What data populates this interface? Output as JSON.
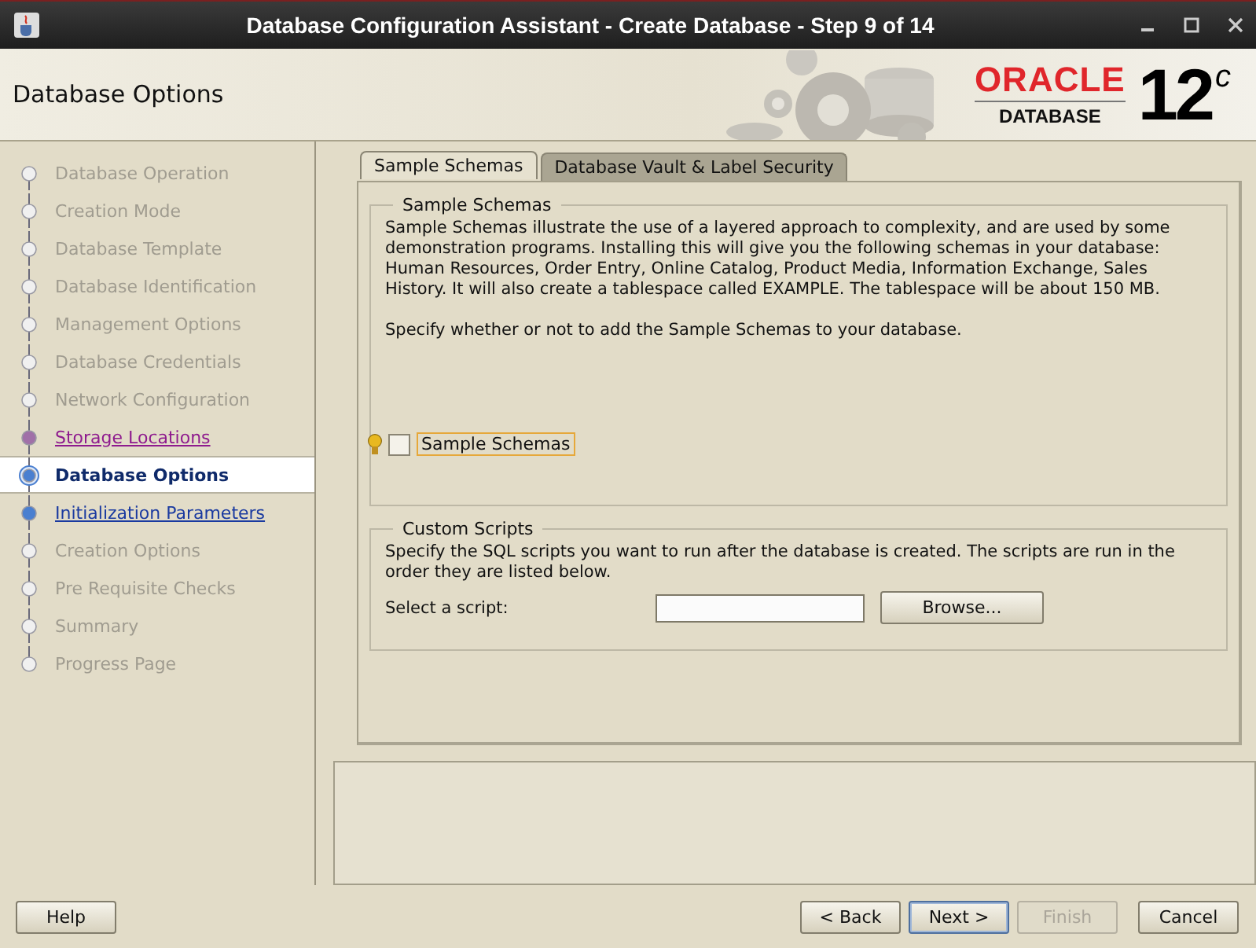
{
  "window": {
    "title": "Database Configuration Assistant - Create Database - Step 9 of 14"
  },
  "header": {
    "title": "Database Options",
    "logo": {
      "brand": "ORACLE",
      "product": "DATABASE",
      "version": "12",
      "suffix": "c"
    }
  },
  "steps": [
    {
      "label": "Database Operation",
      "kind": "pending",
      "selected": false
    },
    {
      "label": "Creation Mode",
      "kind": "pending",
      "selected": false
    },
    {
      "label": "Database Template",
      "kind": "pending",
      "selected": false
    },
    {
      "label": "Database Identification",
      "kind": "pending",
      "selected": false
    },
    {
      "label": "Management Options",
      "kind": "pending",
      "selected": false
    },
    {
      "label": "Database Credentials",
      "kind": "pending",
      "selected": false
    },
    {
      "label": "Network Configuration",
      "kind": "pending",
      "selected": false
    },
    {
      "label": "Storage Locations",
      "kind": "visited",
      "selected": false
    },
    {
      "label": "Database Options",
      "kind": "current",
      "selected": true
    },
    {
      "label": "Initialization Parameters",
      "kind": "link",
      "selected": false
    },
    {
      "label": "Creation Options",
      "kind": "pending",
      "selected": false
    },
    {
      "label": "Pre Requisite Checks",
      "kind": "pending",
      "selected": false
    },
    {
      "label": "Summary",
      "kind": "pending",
      "selected": false
    },
    {
      "label": "Progress Page",
      "kind": "pending",
      "selected": false
    }
  ],
  "tabs": [
    {
      "label": "Sample Schemas",
      "selected": true
    },
    {
      "label": "Database Vault & Label Security",
      "selected": false
    }
  ],
  "sample_schemas": {
    "legend": "Sample Schemas",
    "description": "Sample Schemas illustrate the use of a layered approach to complexity, and are used by some demonstration programs. Installing this will give you the following schemas in your database: Human Resources, Order Entry, Online Catalog, Product Media, Information Exchange, Sales History. It will also create a tablespace called EXAMPLE. The tablespace will be about 150 MB.",
    "instruction": "Specify whether or not to add the Sample Schemas to your database.",
    "checkbox": {
      "label": "Sample Schemas",
      "checked": false,
      "focused": true
    }
  },
  "custom_scripts": {
    "legend": "Custom Scripts",
    "description": "Specify the SQL scripts you want to run after the database is created. The scripts are run in the order they are listed below.",
    "field_label": "Select a script:",
    "browse_button": "Browse..."
  },
  "buttons": [
    {
      "label": "Help",
      "disabled": false,
      "default": false
    },
    {
      "label": "< Back",
      "disabled": false,
      "default": false
    },
    {
      "label": "Next >",
      "disabled": false,
      "default": true
    },
    {
      "label": "Finish",
      "disabled": true,
      "default": false
    },
    {
      "label": "Cancel",
      "disabled": false,
      "default": false
    }
  ]
}
